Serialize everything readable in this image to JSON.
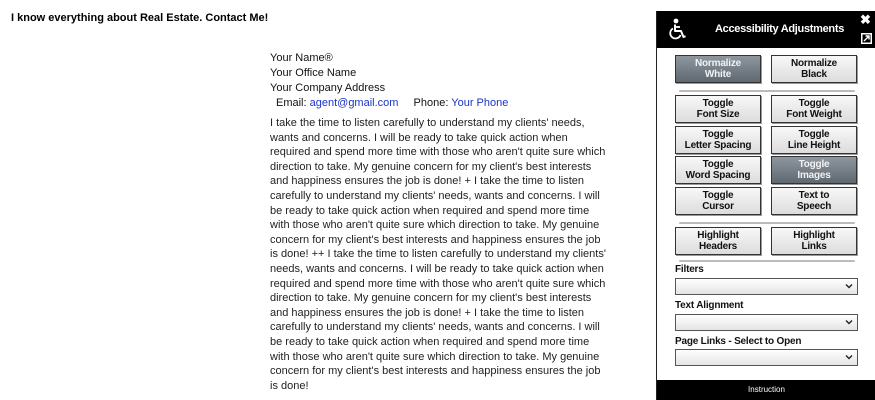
{
  "page": {
    "tagline": "I know everything about Real Estate. Contact Me!",
    "contact": {
      "name": "Your Name®",
      "office": "Your Office Name",
      "address": "Your Company Address",
      "email_label": "Email:",
      "email": "agent@gmail.com",
      "phone_label": "Phone:",
      "phone": "Your Phone"
    },
    "bio": "I take the time to listen carefully to understand my clients' needs, wants and concerns. I will be ready to take quick action when required and spend more time with those who aren't quite sure which direction to take. My genuine concern for my client's best interests and happiness ensures the job is done! + I take the time to listen carefully to understand my clients' needs, wants and concerns. I will be ready to take quick action when required and spend more time with those who aren't quite sure which direction to take. My genuine concern for my client's best interests and happiness ensures the job is done! ++ I take the time to listen carefully to understand my clients' needs, wants and concerns. I will be ready to take quick action when required and spend more time with those who aren't quite sure which direction to take. My genuine concern for my client's best interests and happiness ensures the job is done! + I take the time to listen carefully to understand my clients' needs, wants and concerns. I will be ready to take quick action when required and spend more time with those who aren't quite sure which direction to take. My genuine concern for my client's best interests and happiness ensures the job is done!"
  },
  "panel": {
    "title": "Accessibility Adjustments",
    "icons": {
      "header": "wheelchair-icon",
      "close": "close-icon",
      "popout": "popout-icon"
    },
    "buttons": {
      "normalize_white": "Normalize\nWhite",
      "normalize_black": "Normalize\nBlack",
      "toggle_font_size": "Toggle\nFont Size",
      "toggle_font_weight": "Toggle\nFont Weight",
      "toggle_letter_spacing": "Toggle\nLetter Spacing",
      "toggle_line_height": "Toggle\nLine Height",
      "toggle_word_spacing": "Toggle\nWord Spacing",
      "toggle_images": "Toggle\nImages",
      "toggle_cursor": "Toggle\nCursor",
      "text_to_speech": "Text to\nSpeech",
      "highlight_headers": "Highlight\nHeaders",
      "highlight_links": "Highlight\nLinks"
    },
    "active_buttons": [
      "normalize_white",
      "toggle_images"
    ],
    "filters_label": "Filters",
    "filters_value": "",
    "text_alignment_label": "Text Alignment",
    "text_alignment_value": "",
    "page_links_label": "Page Links - Select to Open",
    "page_links_value": "",
    "footer": "Instruction"
  },
  "colors": {
    "link": "#1a33c8",
    "panel_header": "#000000",
    "active_button": "#6b747c"
  }
}
